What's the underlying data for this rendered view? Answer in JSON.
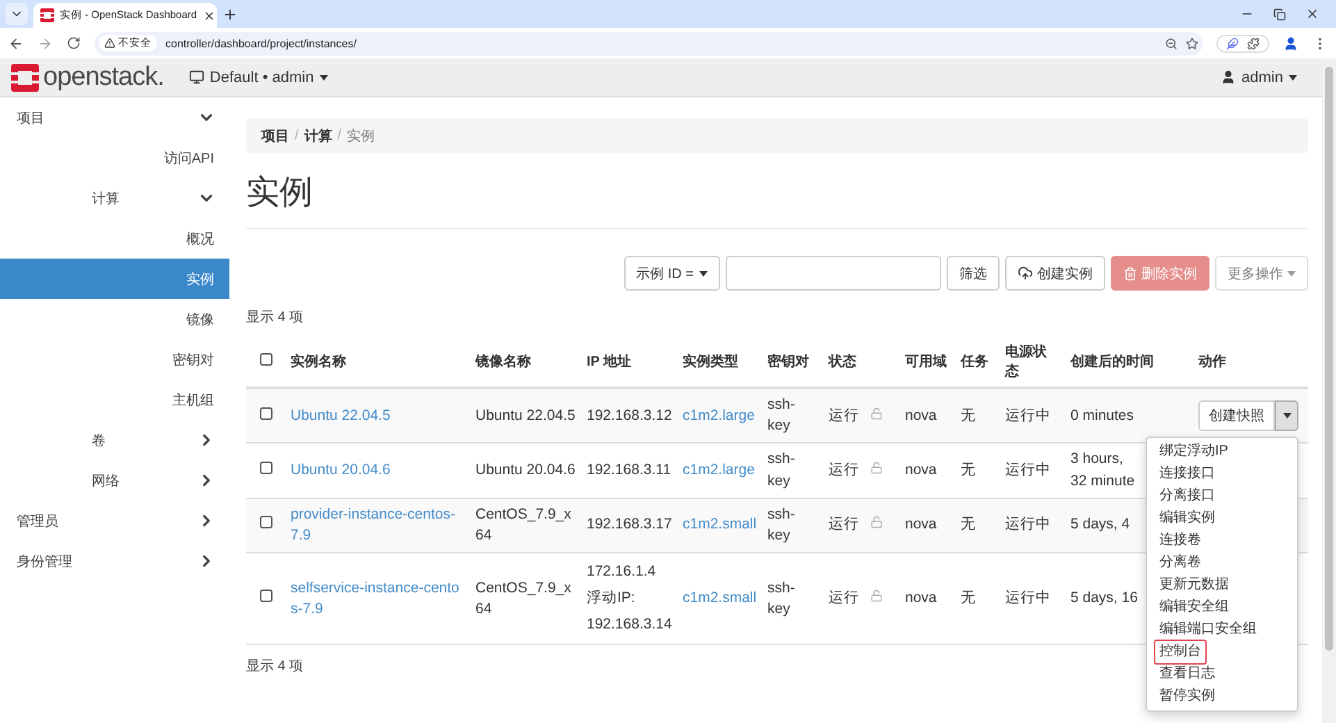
{
  "browser": {
    "tab_title": "实例 - OpenStack Dashboard",
    "security_label": "不安全",
    "url": "controller/dashboard/project/instances/"
  },
  "header": {
    "logo_text": "openstack.",
    "project_selector": "Default • admin",
    "user_menu": "admin"
  },
  "sidebar": {
    "items": [
      {
        "label": "项目",
        "kind": "group",
        "expanded": true,
        "children": [
          {
            "label": "访问API",
            "kind": "panel",
            "selected": false
          },
          {
            "label": "计算",
            "kind": "group",
            "expanded": true,
            "children": [
              {
                "label": "概况",
                "kind": "panel",
                "selected": false
              },
              {
                "label": "实例",
                "kind": "panel",
                "selected": true
              },
              {
                "label": "镜像",
                "kind": "panel",
                "selected": false
              },
              {
                "label": "密钥对",
                "kind": "panel",
                "selected": false
              },
              {
                "label": "主机组",
                "kind": "panel",
                "selected": false
              }
            ]
          },
          {
            "label": "卷",
            "kind": "group",
            "expanded": false
          },
          {
            "label": "网络",
            "kind": "group",
            "expanded": false
          }
        ]
      },
      {
        "label": "管理员",
        "kind": "group",
        "expanded": false
      },
      {
        "label": "身份管理",
        "kind": "group",
        "expanded": false
      }
    ]
  },
  "breadcrumb": {
    "separator": "/",
    "items": [
      "项目",
      "计算",
      "实例"
    ]
  },
  "page_title": "实例",
  "toolbar": {
    "filter_select": "示例 ID =",
    "buttons": [
      {
        "label": "筛选",
        "kind": "plain",
        "disabled": false
      },
      {
        "label": "创建实例",
        "kind": "create",
        "disabled": false
      },
      {
        "label": "删除实例",
        "kind": "delete",
        "disabled": true
      },
      {
        "label": "更多操作",
        "kind": "more",
        "disabled": true
      }
    ]
  },
  "count_top": "显示 4 项",
  "table": {
    "select_all_checked": false,
    "columns": [
      "实例名称",
      "镜像名称",
      "IP 地址",
      "实例类型",
      "密钥对",
      "状态",
      "可用域",
      "任务",
      "电源状态",
      "创建后的时间",
      "动作"
    ],
    "rows": [
      {
        "checked": false,
        "name": "Ubuntu 22.04.5",
        "image": "Ubuntu 22.04.5",
        "ip": [
          "192.168.3.12"
        ],
        "flavor": "c1m2.large",
        "key_pair": "ssh-key",
        "status": "运行",
        "zone": "nova",
        "task": "无",
        "power": "运行中",
        "age": "0 minutes",
        "action": "创建快照"
      },
      {
        "checked": false,
        "name": "Ubuntu 20.04.6",
        "image": "Ubuntu 20.04.6",
        "ip": [
          "192.168.3.11"
        ],
        "flavor": "c1m2.large",
        "key_pair": "ssh-key",
        "status": "运行",
        "zone": "nova",
        "task": "无",
        "power": "运行中",
        "age": "3 hours, 32 minute"
      },
      {
        "checked": false,
        "name": "provider-instance-centos-7.9",
        "image": "CentOS_7.9_x64",
        "ip": [
          "192.168.3.17"
        ],
        "flavor": "c1m2.small",
        "key_pair": "ssh-key",
        "status": "运行",
        "zone": "nova",
        "task": "无",
        "power": "运行中",
        "age": "5 days, 4"
      },
      {
        "checked": false,
        "name": "selfservice-instance-centos-7.9",
        "image": "CentOS_7.9_x64",
        "ip": [
          "172.16.1.4",
          "浮动IP:",
          "192.168.3.14"
        ],
        "flavor": "c1m2.small",
        "key_pair": "ssh-key",
        "status": "运行",
        "zone": "nova",
        "task": "无",
        "power": "运行中",
        "age": "5 days, 16"
      }
    ]
  },
  "action_menu": [
    {
      "label": "绑定浮动IP",
      "highlighted": false
    },
    {
      "label": "连接接口",
      "highlighted": false
    },
    {
      "label": "分离接口",
      "highlighted": false
    },
    {
      "label": "编辑实例",
      "highlighted": false
    },
    {
      "label": "连接卷",
      "highlighted": false
    },
    {
      "label": "分离卷",
      "highlighted": false
    },
    {
      "label": "更新元数据",
      "highlighted": false
    },
    {
      "label": "编辑安全组",
      "highlighted": false
    },
    {
      "label": "编辑端口安全组",
      "highlighted": false
    },
    {
      "label": "控制台",
      "highlighted": true
    },
    {
      "label": "查看日志",
      "highlighted": false
    },
    {
      "label": "暂停实例",
      "highlighted": false
    }
  ],
  "count_bottom": "显示 4 项"
}
